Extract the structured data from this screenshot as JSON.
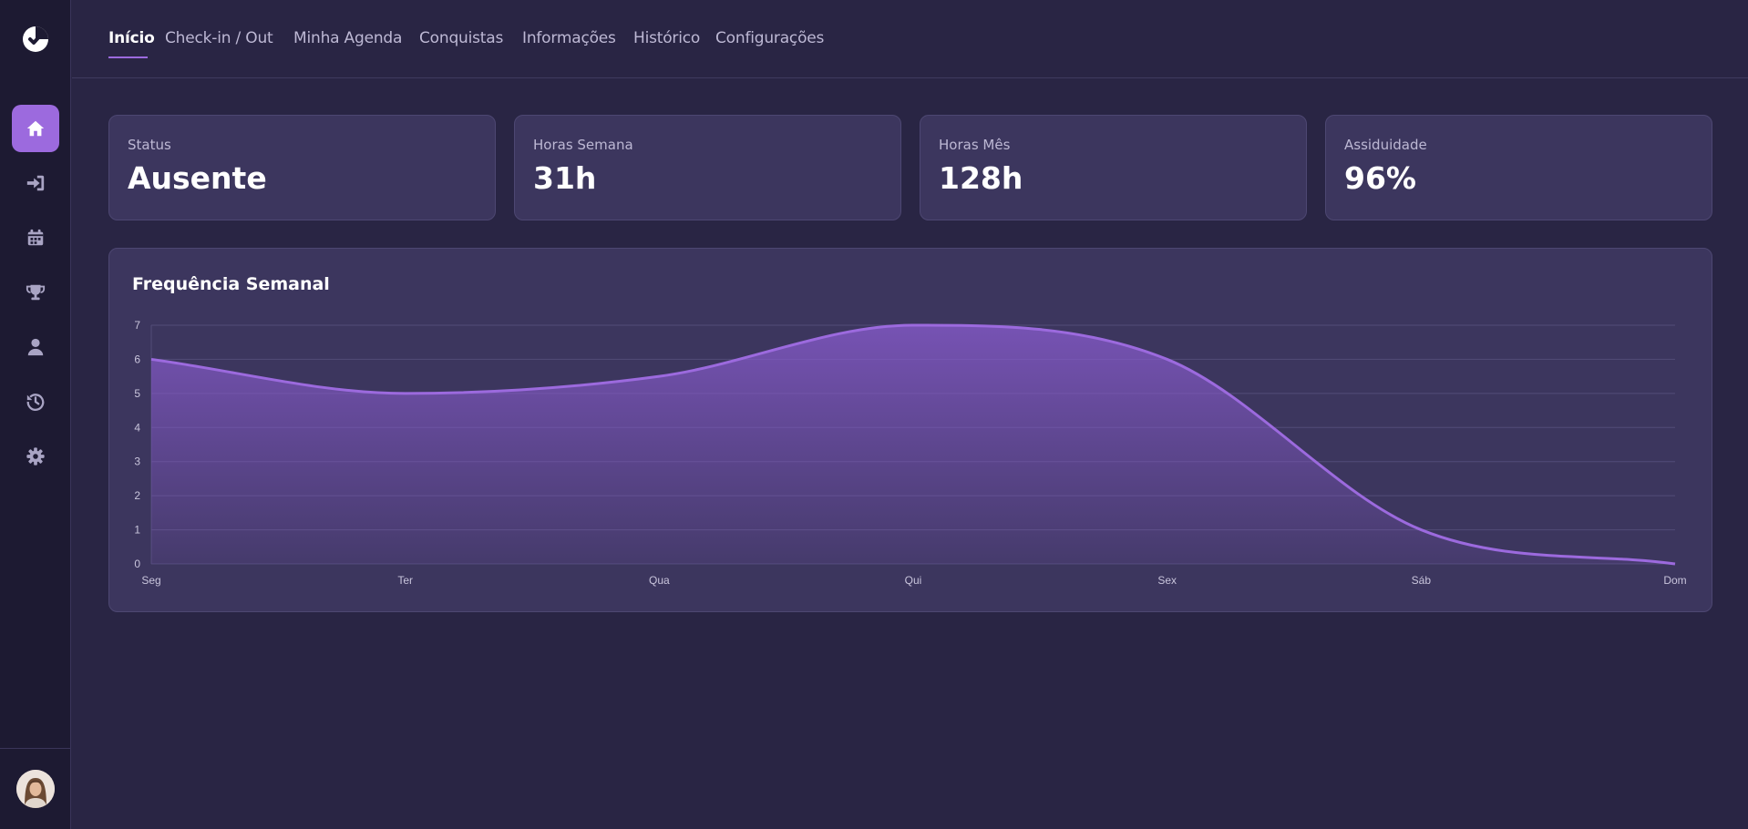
{
  "nav": {
    "tabs": [
      {
        "label": "Início"
      },
      {
        "label": "Check-in / Out"
      },
      {
        "label": "Minha Agenda"
      },
      {
        "label": "Conquistas"
      },
      {
        "label": "Informações"
      },
      {
        "label": "Histórico"
      },
      {
        "label": "Configurações"
      }
    ],
    "active_tab": "Início"
  },
  "sidebar": {
    "icons": [
      "home-icon",
      "sign-in-icon",
      "calendar-icon",
      "trophy-icon",
      "user-icon",
      "history-icon",
      "gear-icon"
    ],
    "active_icon": "home-icon",
    "accent_color": "#9c6ade"
  },
  "stats": [
    {
      "label": "Status",
      "value": "Ausente"
    },
    {
      "label": "Horas Semana",
      "value": "31h"
    },
    {
      "label": "Horas Mês",
      "value": "128h"
    },
    {
      "label": "Assiduidade",
      "value": "96%"
    }
  ],
  "chart_data": {
    "type": "area",
    "title": "Frequência Semanal",
    "categories": [
      "Seg",
      "Ter",
      "Qua",
      "Qui",
      "Sex",
      "Sáb",
      "Dom"
    ],
    "values": [
      6,
      5,
      5.5,
      7,
      6,
      1,
      0
    ],
    "ylim": [
      0,
      7
    ],
    "yticks": [
      "0",
      "1",
      "2",
      "3",
      "4",
      "5",
      "6",
      "7"
    ],
    "grid": true,
    "line_color": "#9c6ade",
    "fill_color": "#8a5cd0"
  }
}
